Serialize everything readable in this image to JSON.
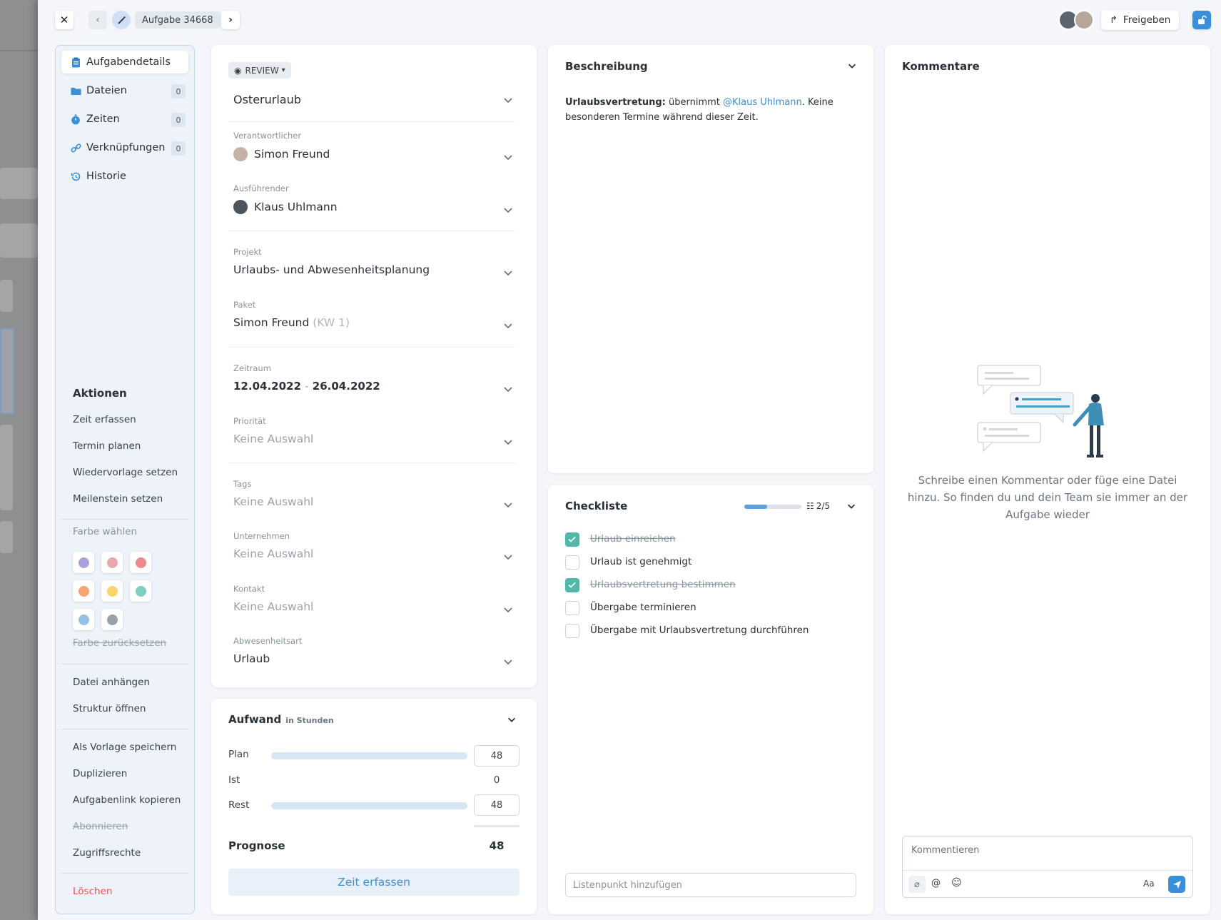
{
  "task": {
    "label": "Aufgabe 34668"
  },
  "header": {
    "share_label": "Freigeben"
  },
  "sidebar": {
    "items": [
      {
        "label": "Aufgabendetails"
      },
      {
        "label": "Dateien",
        "count": "0"
      },
      {
        "label": "Zeiten",
        "count": "0"
      },
      {
        "label": "Verknüpfungen",
        "count": "0"
      },
      {
        "label": "Historie"
      }
    ],
    "actions_title": "Aktionen",
    "actions": [
      "Zeit erfassen",
      "Termin planen",
      "Wiedervorlage setzen",
      "Meilenstein setzen"
    ],
    "color_title": "Farbe wählen",
    "colors": [
      "#a9a0dc",
      "#e8a7ad",
      "#ea8a8e",
      "#f5a472",
      "#f8d46a",
      "#7fcfc0",
      "#93c2e8",
      "#9aa0a6"
    ],
    "color_reset": "Farbe zurücksetzen",
    "actions2": [
      "Datei anhängen",
      "Struktur öffnen"
    ],
    "actions3": [
      "Als Vorlage speichern",
      "Duplizieren",
      "Aufgabenlink kopieren",
      "Abonnieren",
      "Zugriffsrechte"
    ],
    "delete": "Löschen"
  },
  "details": {
    "status": "REVIEW",
    "title": "Osterurlaub",
    "responsible_label": "Verantwortlicher",
    "responsible": "Simon Freund",
    "executor_label": "Ausführender",
    "executor": "Klaus Uhlmann",
    "project_label": "Projekt",
    "project": "Urlaubs- und Abwesenheitsplanung",
    "package_label": "Paket",
    "package": "Simon Freund",
    "package_suffix": "(KW 1)",
    "period_label": "Zeitraum",
    "period_start": "12.04.2022",
    "period_sep": "-",
    "period_end": "26.04.2022",
    "priority_label": "Priorität",
    "priority": "Keine Auswahl",
    "tags_label": "Tags",
    "tags": "Keine Auswahl",
    "company_label": "Unternehmen",
    "company": "Keine Auswahl",
    "contact_label": "Kontakt",
    "contact": "Keine Auswahl",
    "absence_label": "Abwesenheitsart",
    "absence": "Urlaub"
  },
  "effort": {
    "title": "Aufwand",
    "unit": "in Stunden",
    "plan_label": "Plan",
    "plan": "48",
    "ist_label": "Ist",
    "ist": "0",
    "rest_label": "Rest",
    "rest": "48",
    "forecast_label": "Prognose",
    "forecast": "48",
    "button": "Zeit erfassen"
  },
  "description": {
    "title": "Beschreibung",
    "bold": "Urlaubsvertretung:",
    "text1": " übernimmt ",
    "mention": "@Klaus Uhlmann",
    "text2": ". Keine besonderen Termine während dieser Zeit."
  },
  "checklist": {
    "title": "Checkliste",
    "progress": "2/5",
    "progress_fraction": 0.4,
    "items": [
      {
        "text": "Urlaub einreichen",
        "done": true
      },
      {
        "text": "Urlaub ist genehmigt",
        "done": false
      },
      {
        "text": "Urlaubsvertretung bestimmen",
        "done": true
      },
      {
        "text": "Übergabe terminieren",
        "done": false
      },
      {
        "text": "Übergabe mit Urlaubsvertretung durchführen",
        "done": false
      }
    ],
    "add_placeholder": "Listenpunkt hinzufügen"
  },
  "comments": {
    "title": "Kommentare",
    "empty_text": "Schreibe einen Kommentar oder füge eine Datei hinzu. So finden du und dein Team sie immer an der Aufgabe wieder",
    "input_placeholder": "Kommentieren",
    "format_label": "Aa"
  },
  "colors": {
    "accent": "#3a8fd9",
    "check": "#4fb8a8",
    "danger": "#e5534b"
  }
}
